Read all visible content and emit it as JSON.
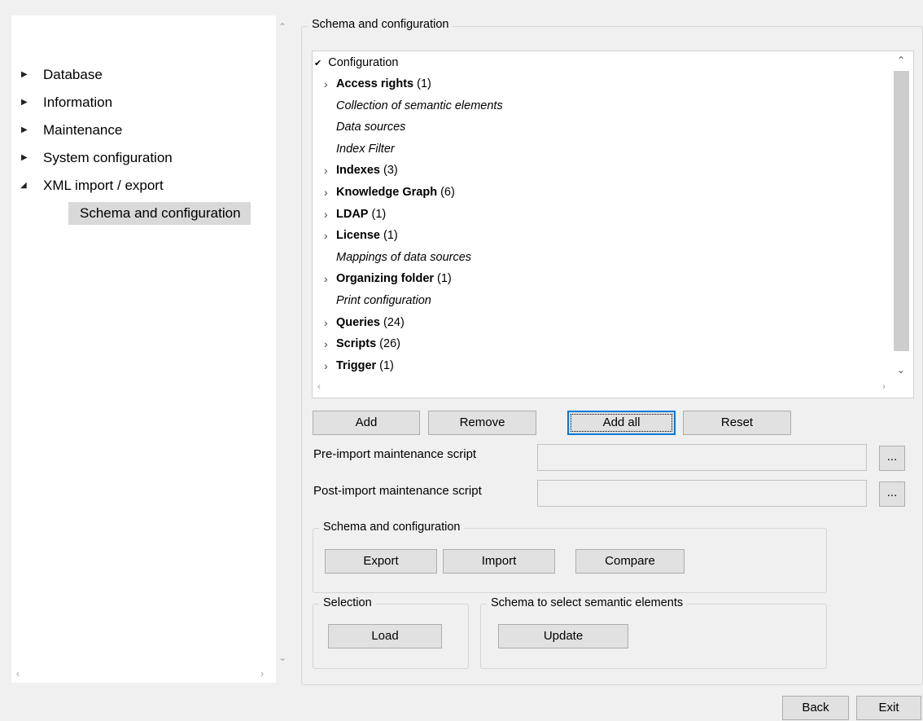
{
  "nav": {
    "items": [
      {
        "label": "Database",
        "expanded": false
      },
      {
        "label": "Information",
        "expanded": false
      },
      {
        "label": "Maintenance",
        "expanded": false
      },
      {
        "label": "System configuration",
        "expanded": false
      },
      {
        "label": "XML import / export",
        "expanded": true
      }
    ],
    "selected_child": "Schema and configuration"
  },
  "main_group": {
    "title": "Schema and configuration"
  },
  "tree": {
    "root": "Configuration",
    "items": [
      {
        "name": "Access rights",
        "count": "(1)",
        "expandable": true
      },
      {
        "name": "Collection of semantic elements",
        "count": "",
        "expandable": false
      },
      {
        "name": "Data sources",
        "count": "",
        "expandable": false
      },
      {
        "name": "Index Filter",
        "count": "",
        "expandable": false
      },
      {
        "name": "Indexes",
        "count": "(3)",
        "expandable": true
      },
      {
        "name": "Knowledge Graph",
        "count": "(6)",
        "expandable": true
      },
      {
        "name": "LDAP",
        "count": "(1)",
        "expandable": true
      },
      {
        "name": "License",
        "count": "(1)",
        "expandable": true
      },
      {
        "name": "Mappings of data sources",
        "count": "",
        "expandable": false
      },
      {
        "name": "Organizing folder",
        "count": "(1)",
        "expandable": true
      },
      {
        "name": "Print configuration",
        "count": "",
        "expandable": false
      },
      {
        "name": "Queries",
        "count": "(24)",
        "expandable": true
      },
      {
        "name": "Scripts",
        "count": "(26)",
        "expandable": true
      },
      {
        "name": "Trigger",
        "count": "(1)",
        "expandable": true
      }
    ]
  },
  "buttons": {
    "add": "Add",
    "remove": "Remove",
    "add_all": "Add all",
    "reset": "Reset",
    "export": "Export",
    "import": "Import",
    "compare": "Compare",
    "load": "Load",
    "update": "Update",
    "back": "Back",
    "exit": "Exit",
    "browse": "..."
  },
  "fields": {
    "pre_import_label": "Pre-import maintenance script",
    "pre_import_value": "",
    "post_import_label": "Post-import maintenance script",
    "post_import_value": ""
  },
  "groups": {
    "schema_config": "Schema and configuration",
    "selection": "Selection",
    "schema_select": "Schema to select semantic elements"
  },
  "colors": {
    "default_button_border": "#0078d7",
    "selected_nav_bg": "#d9d9d9"
  }
}
